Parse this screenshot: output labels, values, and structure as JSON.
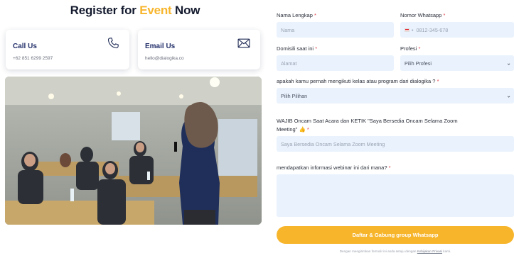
{
  "header": {
    "title_pre": "Register for",
    "title_accent": "Event",
    "title_post": "Now"
  },
  "contacts": {
    "call": {
      "label": "Call Us",
      "value": "+62 851 6299 2597",
      "icon": "phone-icon"
    },
    "email": {
      "label": "Email Us",
      "value": "hello@dialogika.co",
      "icon": "envelope-icon"
    }
  },
  "form": {
    "nama": {
      "label": "Nama Lengkap",
      "required": "*",
      "placeholder": "Nama"
    },
    "whatsapp": {
      "label": "Nomor Whatsapp",
      "required": "*",
      "flag": "id-flag-icon",
      "dial": "•",
      "placeholder": "0812-345-678"
    },
    "domisili": {
      "label": "Domisili saat ini",
      "required": "*",
      "placeholder": "Alamat"
    },
    "profesi": {
      "label": "Profesi",
      "required": "*",
      "value": "Pilih Profesi"
    },
    "pernah": {
      "label": "apakah kamu pernah mengikuti kelas atau program dari dialogika ?",
      "required": "*",
      "value": "Pilih Pilihan"
    },
    "wajib": {
      "label_line1": "WAJIB Oncam Saat Acara dan KETIK \"Saya Bersedia Oncam Selama Zoom",
      "label_line2": "Meeting\"",
      "emoji": "👍",
      "required": "*",
      "placeholder": "Saya Bersedia Oncam Selama Zoom Meeting"
    },
    "sumber": {
      "label": "mendapatkan informasi webinar ini dari mana?",
      "required": "*"
    },
    "submit_label": "Daftar & Gabung group Whatsapp",
    "footnote_pre": "Dengan mengirimkan formulir ini anda setuju dengan",
    "footnote_link": "Kebijakan Privasi",
    "footnote_post": "kami."
  },
  "colors": {
    "accent": "#f7b52c",
    "title": "#141a2e",
    "field_bg": "#e9f2fd",
    "required": "#e0414b",
    "contact_label": "#23306a"
  }
}
